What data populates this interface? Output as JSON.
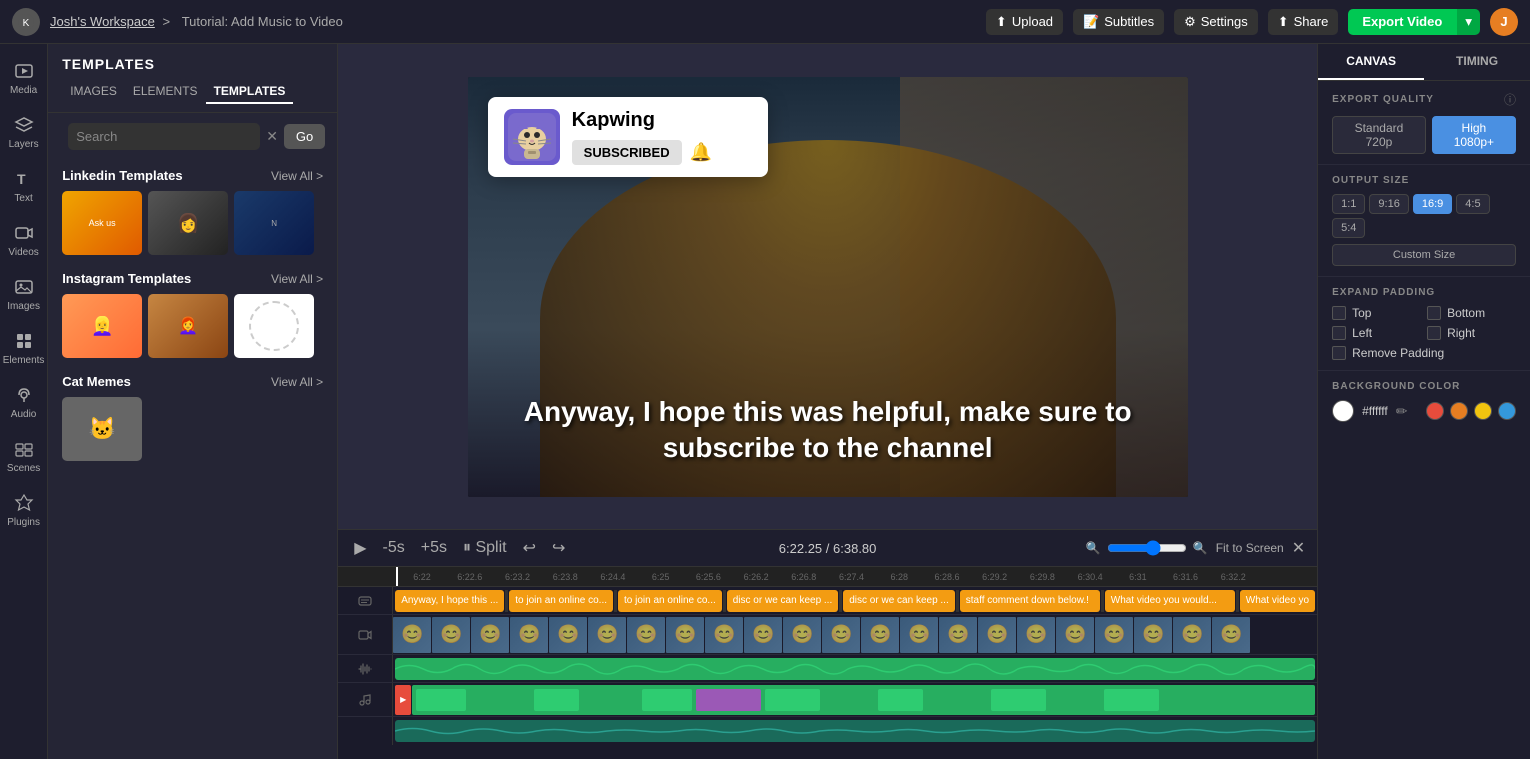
{
  "nav": {
    "workspace": "Josh's Workspace",
    "breadcrumb_separator": ">",
    "project_title": "Tutorial: Add Music to Video",
    "upload_label": "Upload",
    "subtitles_label": "Subtitles",
    "settings_label": "Settings",
    "share_label": "Share",
    "export_label": "Export Video",
    "user_initial": "J"
  },
  "sidebar": {
    "media_label": "Media",
    "layers_label": "Layers",
    "text_label": "Text",
    "videos_label": "Videos",
    "images_label": "Images",
    "elements_label": "Elements",
    "audio_label": "Audio",
    "scenes_label": "Scenes",
    "plugins_label": "Plugins"
  },
  "panel": {
    "header": "TEMPLATES",
    "tab_images": "IMAGES",
    "tab_elements": "ELEMENTS",
    "tab_templates": "TEMPLATES",
    "search_placeholder": "Search",
    "go_btn": "Go",
    "sections": [
      {
        "title": "Linkedin Templates",
        "view_all": "View All >"
      },
      {
        "title": "Instagram Templates",
        "view_all": "View All >"
      },
      {
        "title": "Cat Memes",
        "view_all": "View All >"
      }
    ]
  },
  "canvas": {
    "channel_name": "Kapwing",
    "subscribe_btn": "SUBSCRIBED",
    "subtitle_text": "Anyway, I hope this was helpful, make sure to subscribe to the channel"
  },
  "timeline": {
    "minus_label": "-5s",
    "plus_label": "+5s",
    "split_label": "Split",
    "time_current": "6:22.25",
    "time_separator": "/",
    "time_total": "6:38.80",
    "fit_label": "Fit to Screen",
    "ruler_marks": [
      "6:22",
      "6:22.6",
      "6:23.2",
      "6:23.8",
      "6:24.4",
      "6:25",
      "6:25.6",
      "6:26.2",
      "6:26.8",
      "6:27.4",
      "6:28",
      "6:28.6",
      "6:29.2",
      "6:29.8",
      "6:30.4",
      "6:31",
      "6:31.6",
      "6:32.2"
    ],
    "subtitle_segments": [
      {
        "text": "Anyway, I hope this ...",
        "color": "orange"
      },
      {
        "text": "to join an online co...",
        "color": "orange"
      },
      {
        "text": "to join an online co...",
        "color": "orange"
      },
      {
        "text": "disc or we can keep ...",
        "color": "orange"
      },
      {
        "text": "disc or we can keep ...",
        "color": "orange"
      },
      {
        "text": "staff comment down below.!",
        "color": "orange"
      },
      {
        "text": "What video you would...",
        "color": "orange"
      },
      {
        "text": "What video yo",
        "color": "orange"
      }
    ]
  },
  "right_panel": {
    "tab_canvas": "CANVAS",
    "tab_timing": "TIMING",
    "export_quality_label": "EXPORT QUALITY",
    "standard_label": "Standard 720p",
    "high_label": "High 1080p+",
    "output_size_label": "OUTPUT SIZE",
    "sizes": [
      "1:1",
      "9:16",
      "16:9",
      "4:5",
      "5:4"
    ],
    "active_size": "16:9",
    "custom_size_label": "Custom Size",
    "expand_padding_label": "EXPAND PADDING",
    "expand_top": "Top",
    "expand_bottom": "Bottom",
    "expand_left": "Left",
    "expand_right": "Right",
    "remove_padding": "Remove Padding",
    "bg_color_label": "BACKGROUND COLOR",
    "color_hex": "#ffffff",
    "color_swatches": [
      "#e74c3c",
      "#e67e22",
      "#f1c40f",
      "#3498db"
    ]
  }
}
